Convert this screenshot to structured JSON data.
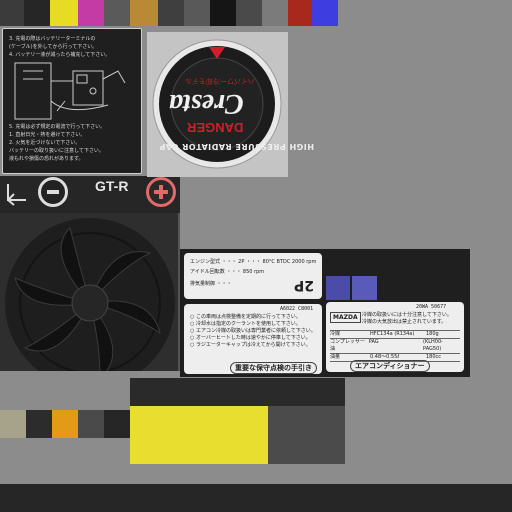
{
  "colors": {
    "background": "#8c8c8c",
    "dark_panel": "#2a2a2a",
    "fan_panel": "#303030",
    "label_white": "#eeeeee",
    "danger_red": "#d01e2a",
    "accent_yellow": "#e7de2f",
    "accent_blue": "#4b4ba8"
  },
  "top_swatches": [
    "#3b3b3b",
    "#262626",
    "#e5dc23",
    "#c43ba6",
    "#5a5a5a",
    "#b98a35",
    "#3f3f3f",
    "#595959",
    "#151515",
    "#4a4a4a",
    "#7b7b7b",
    "#a8281e",
    "#3e3ee0"
  ],
  "bottom_swatches": [
    "#a7a28a",
    "#2c2c2c",
    "#e39a17",
    "#4a4a4a",
    "#262626"
  ],
  "radiator_cap": {
    "brand": "Cresta",
    "danger_text": "DANGER",
    "ring_text": "HIGH PRESSURE RADIATOR CAP",
    "jp_line": "ハイパワー冷却モデル"
  },
  "battery": {
    "model": "GT-R",
    "minus_icon": "minus-icon",
    "plus_icon": "plus-icon",
    "arrow_icon": "arrow-icon",
    "instructions": [
      "3. 充電の際はバッテリーターミナルの",
      "(ケーブル)を外してから行って下さい。",
      "4. バッテリー液が減ったら補充して下さい。",
      "5. 充電は必ず規定の電流で行って下さい。",
      "1. 直射日光・熱を避けて下さい。",
      "2. 火気を近づけないで下さい。",
      "バッテリーの取り扱いに注意して下さい。",
      "液もれや損傷の恐れがあります。"
    ]
  },
  "label_top": {
    "rows": [
      "エンジン型式 ・・・ 2P ・・・ 80°C BTDC 2000 rpm",
      "アイドル回転数 ・・・ 850 rpm",
      "排気量制御 ・・・"
    ],
    "code": "2P"
  },
  "label_left": {
    "code": "A6022 C8001",
    "title": "重要な保守点検の手引き",
    "lines": [
      "○ この車両は点検整備を定期的に行って下さい。",
      "○ 冷却水は指定のクーラントを使用して下さい。",
      "○ エアコン冷媒の取扱いは専門業者に依頼して下さい。",
      "○ オーバーヒートした時は速やかに停車して下さい。",
      "○ ラジエーターキャップは冷えてから開けて下さい。"
    ]
  },
  "label_right": {
    "code": "20WA 50677",
    "title": "エアコンディショナー",
    "maker": "MAZDA",
    "lines": [
      "冷媒の取扱いには十分注意して下さい。",
      "冷媒の大気放出は禁止されています。"
    ],
    "spec_rows": [
      {
        "k": "冷媒",
        "v": "HFC134a (R134a)",
        "v2": "180g"
      },
      {
        "k": "コンプレッサー油",
        "v": "PAG",
        "v2": "(KLH00-PAG50)"
      },
      {
        "k": "油量",
        "v": "0.48〜0.55ℓ",
        "v2": "180cc"
      }
    ]
  }
}
